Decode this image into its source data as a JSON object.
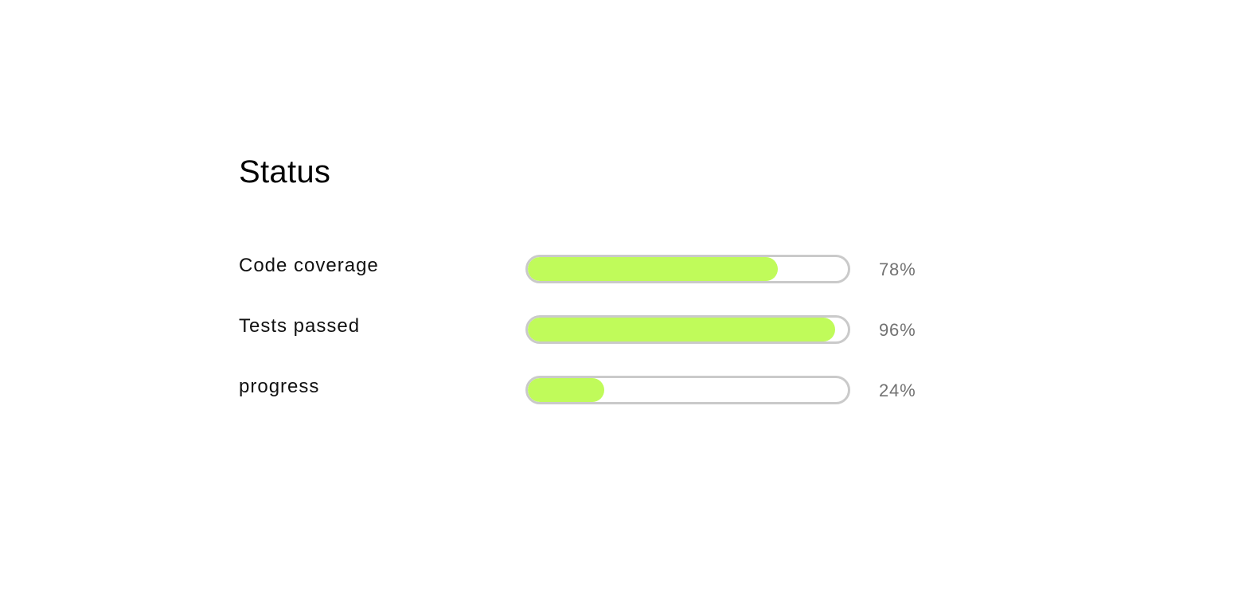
{
  "page": {
    "title": "Status"
  },
  "status": {
    "items": [
      {
        "label": "Code coverage",
        "value_text": "78%",
        "value": 78
      },
      {
        "label": "Tests passed",
        "value_text": "96%",
        "value": 96
      },
      {
        "label": "progress",
        "value_text": "24%",
        "value": 24
      }
    ]
  },
  "colors": {
    "fill": "#c0fb5a",
    "track_border": "#cacaca",
    "label": "#111111",
    "value": "#727272"
  }
}
